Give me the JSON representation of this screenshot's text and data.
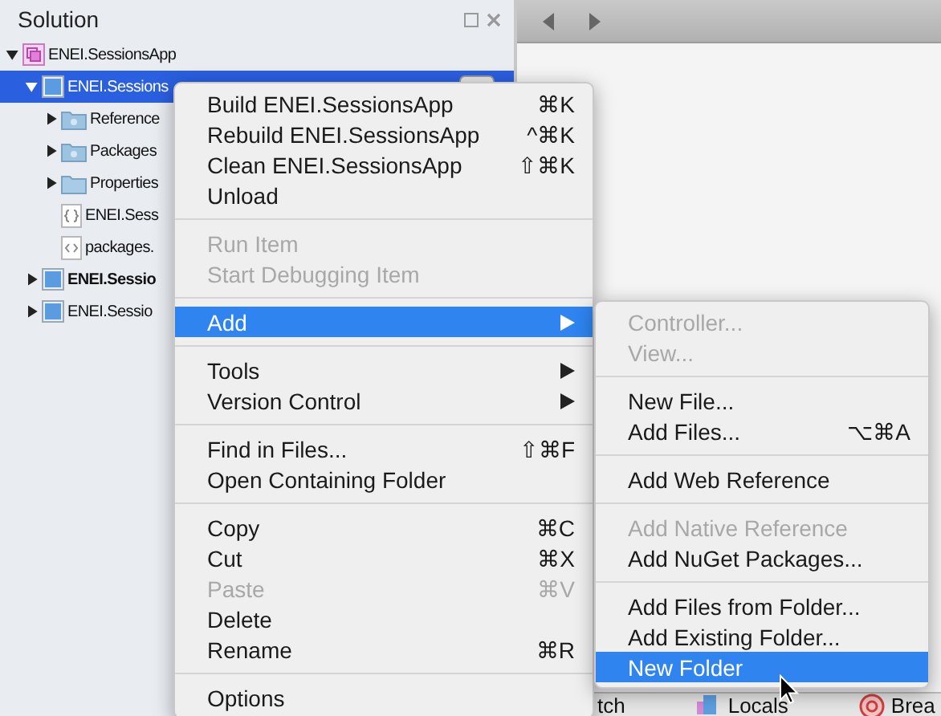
{
  "sidebar": {
    "title": "Solution",
    "tree": [
      {
        "label": "ENEI.SessionsApp",
        "kind": "solution",
        "bold": false,
        "selected": false,
        "expanded": true,
        "children": [
          {
            "label": "ENEI.Sessions",
            "kind": "project",
            "bold": false,
            "selected": true,
            "expanded": true,
            "children": [
              {
                "label": "Reference",
                "kind": "special-folder",
                "bold": false,
                "selected": false,
                "expanded": false
              },
              {
                "label": "Packages",
                "kind": "special-folder",
                "bold": false,
                "selected": false,
                "expanded": false
              },
              {
                "label": "Properties",
                "kind": "folder",
                "bold": false,
                "selected": false,
                "expanded": false
              },
              {
                "label": "ENEI.Sess",
                "kind": "json-file",
                "bold": false,
                "selected": false
              },
              {
                "label": "packages.",
                "kind": "xml-file",
                "bold": false,
                "selected": false
              }
            ]
          },
          {
            "label": "ENEI.Sessio",
            "kind": "project",
            "bold": true,
            "selected": false,
            "expanded": false
          },
          {
            "label": "ENEI.Sessio",
            "kind": "project",
            "bold": false,
            "selected": false,
            "expanded": false
          }
        ]
      }
    ]
  },
  "context_menu": [
    [
      {
        "label": "Build ENEI.SessionsApp",
        "shortcut": "⌘K",
        "disabled": false,
        "selected": false,
        "submenu": false
      },
      {
        "label": "Rebuild ENEI.SessionsApp",
        "shortcut": "^⌘K",
        "disabled": false,
        "selected": false,
        "submenu": false
      },
      {
        "label": "Clean ENEI.SessionsApp",
        "shortcut": "⇧⌘K",
        "disabled": false,
        "selected": false,
        "submenu": false
      },
      {
        "label": "Unload",
        "disabled": false,
        "selected": false,
        "submenu": false
      }
    ],
    [
      {
        "label": "Run Item",
        "disabled": true,
        "selected": false,
        "submenu": false
      },
      {
        "label": "Start Debugging Item",
        "disabled": true,
        "selected": false,
        "submenu": false
      }
    ],
    [
      {
        "label": "Add",
        "disabled": false,
        "selected": true,
        "submenu": true
      }
    ],
    [
      {
        "label": "Tools",
        "disabled": false,
        "selected": false,
        "submenu": true
      },
      {
        "label": "Version Control",
        "disabled": false,
        "selected": false,
        "submenu": true
      }
    ],
    [
      {
        "label": "Find in Files...",
        "shortcut": "⇧⌘F",
        "disabled": false,
        "selected": false,
        "submenu": false
      },
      {
        "label": "Open Containing Folder",
        "disabled": false,
        "selected": false,
        "submenu": false
      }
    ],
    [
      {
        "label": "Copy",
        "shortcut": "⌘C",
        "disabled": false,
        "selected": false,
        "submenu": false
      },
      {
        "label": "Cut",
        "shortcut": "⌘X",
        "disabled": false,
        "selected": false,
        "submenu": false
      },
      {
        "label": "Paste",
        "shortcut": "⌘V",
        "disabled": true,
        "selected": false,
        "submenu": false
      },
      {
        "label": "Delete",
        "disabled": false,
        "selected": false,
        "submenu": false
      },
      {
        "label": "Rename",
        "shortcut": "⌘R",
        "disabled": false,
        "selected": false,
        "submenu": false
      }
    ],
    [
      {
        "label": "Options",
        "disabled": false,
        "selected": false,
        "submenu": false
      }
    ]
  ],
  "add_submenu": [
    [
      {
        "label": "Controller...",
        "disabled": true,
        "selected": false
      },
      {
        "label": "View...",
        "disabled": true,
        "selected": false
      }
    ],
    [
      {
        "label": "New File...",
        "disabled": false,
        "selected": false
      },
      {
        "label": "Add Files...",
        "shortcut": "⌥⌘A",
        "disabled": false,
        "selected": false
      }
    ],
    [
      {
        "label": "Add Web Reference",
        "disabled": false,
        "selected": false
      }
    ],
    [
      {
        "label": "Add Native Reference",
        "disabled": true,
        "selected": false
      },
      {
        "label": "Add NuGet Packages...",
        "disabled": false,
        "selected": false
      }
    ],
    [
      {
        "label": "Add Files from Folder...",
        "disabled": false,
        "selected": false
      },
      {
        "label": "Add Existing Folder...",
        "disabled": false,
        "selected": false
      },
      {
        "label": "New Folder",
        "disabled": false,
        "selected": true
      }
    ]
  ],
  "bottom_pads": [
    {
      "label": "tch",
      "kind": "plain"
    },
    {
      "label": "Locals",
      "kind": "locals"
    },
    {
      "label": "Brea",
      "kind": "breakpoints"
    }
  ]
}
